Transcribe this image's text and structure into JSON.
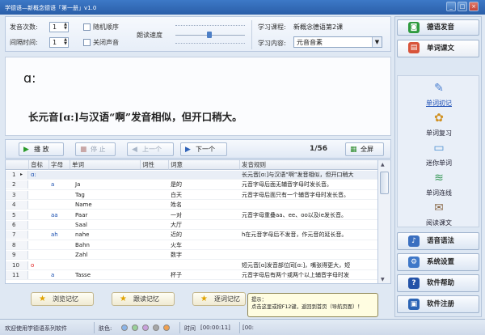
{
  "window": {
    "title": "学德语—新概念德语「第一册」v1.0",
    "minimize": "_",
    "maximize": "□",
    "close": "×"
  },
  "controls": {
    "play_times_label": "发音次数:",
    "play_times_value": "1",
    "interval_label": "间隔时间:",
    "interval_value": "1",
    "random_label": "随机顺序",
    "mute_label": "关闭声音",
    "speed_label": "朗读速度",
    "course_label": "学习课程:",
    "course_value": "新概念德语第2课",
    "content_label": "学习内容:",
    "content_value": "元音音素"
  },
  "display": {
    "phonetic": "ɑ:",
    "explanation": "长元音[ɑ:]与汉语“啊”发音相似，但开口稍大。"
  },
  "toolbar": {
    "play": "播 放",
    "stop": "停 止",
    "prev": "上一个",
    "next": "下一个",
    "pager": "1/56",
    "fullscreen": "全屏"
  },
  "table": {
    "headers": [
      "",
      "音标",
      "字母",
      "单词",
      "词性",
      "词意",
      "发音规则"
    ],
    "rows": [
      {
        "num": "1",
        "marker": "▸",
        "phonetic": "ɑ:",
        "letter": "",
        "word": "",
        "pos": "",
        "meaning": "",
        "rule": "长元音[ɑ:]与汉语“啊”发音相似，但开口稍大"
      },
      {
        "num": "2",
        "marker": "",
        "phonetic": "",
        "letter": "a",
        "word": "Ja",
        "pos": "",
        "meaning": "是的",
        "rule": "元音字母后面无辅音字母时发长音。"
      },
      {
        "num": "3",
        "marker": "",
        "phonetic": "",
        "letter": "",
        "word": "Tag",
        "pos": "",
        "meaning": "白天",
        "rule": "元音字母后面只有一个辅音字母时发长音。"
      },
      {
        "num": "4",
        "marker": "",
        "phonetic": "",
        "letter": "",
        "word": "Name",
        "pos": "",
        "meaning": "姓名",
        "rule": ""
      },
      {
        "num": "5",
        "marker": "",
        "phonetic": "",
        "letter": "aa",
        "word": "Paar",
        "pos": "",
        "meaning": "一对",
        "rule": "元音字母重叠aa、ee、oo以及ie发长音。"
      },
      {
        "num": "6",
        "marker": "",
        "phonetic": "",
        "letter": "",
        "word": "Saal",
        "pos": "",
        "meaning": "大厅",
        "rule": ""
      },
      {
        "num": "7",
        "marker": "",
        "phonetic": "",
        "letter": "ah",
        "word": "nahe",
        "pos": "",
        "meaning": "近的",
        "rule": "h在元音字母后不发音，作元音的延长音。"
      },
      {
        "num": "8",
        "marker": "",
        "phonetic": "",
        "letter": "",
        "word": "Bahn",
        "pos": "",
        "meaning": "火车",
        "rule": ""
      },
      {
        "num": "9",
        "marker": "",
        "phonetic": "",
        "letter": "",
        "word": "Zahl",
        "pos": "",
        "meaning": "数字",
        "rule": ""
      },
      {
        "num": "10",
        "marker": "",
        "phonetic": "o",
        "letter": "",
        "word": "",
        "pos": "",
        "meaning": "",
        "rule": "短元音[ɑ]发音部位同[ɑ:]，嘴张得更大，短"
      },
      {
        "num": "11",
        "marker": "",
        "phonetic": "",
        "letter": "a",
        "word": "Tasse",
        "pos": "",
        "meaning": "杯子",
        "rule": "元音字母后有两个或两个以上辅音字母时发"
      }
    ]
  },
  "bottom": {
    "browse": "浏览记忆",
    "follow": "跟读记忆",
    "word_by_word": "逐词记忆"
  },
  "tooltip": {
    "line1": "提示：",
    "line2": "点击这里或按F12键，返回到首页（导航页面）！"
  },
  "status": {
    "welcome": "欢迎使用学德语系列软件",
    "skin_label": "肤色:",
    "skins": [
      "#8ab4e8",
      "#9ad09a",
      "#c9a0dc",
      "#a7a7a7",
      "#f0a050"
    ],
    "time_label": "时间",
    "time_value": "[00:00:11]",
    "extra": "[00:"
  },
  "sidebar": {
    "top": "德语发音",
    "active": "单词课文",
    "items": [
      {
        "label": "单词初记",
        "icon": "✎"
      },
      {
        "label": "单词复习",
        "icon": "✿"
      },
      {
        "label": "迷你单词",
        "icon": "▭"
      },
      {
        "label": "单词连线",
        "icon": "≋"
      },
      {
        "label": "阅读课文",
        "icon": "✉"
      }
    ],
    "bottom": [
      {
        "label": "语音语法",
        "icon": "♪",
        "color": "#3a6fc0"
      },
      {
        "label": "系统设置",
        "icon": "⚙",
        "color": "#3f78c8"
      },
      {
        "label": "软件帮助",
        "icon": "?",
        "color": "#2453a8"
      },
      {
        "label": "软件注册",
        "icon": "▣",
        "color": "#2b64b5"
      }
    ]
  }
}
